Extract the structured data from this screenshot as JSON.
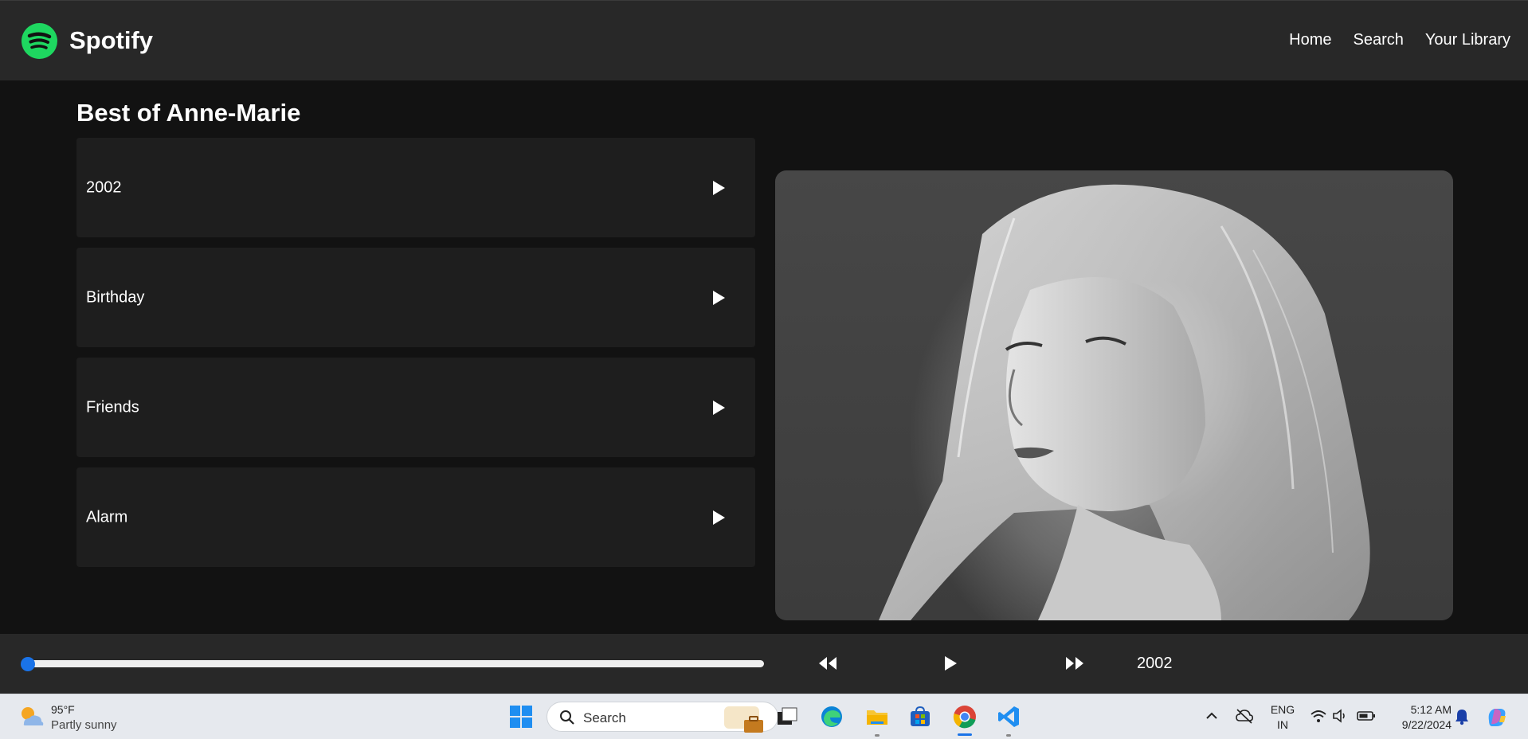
{
  "header": {
    "brand": "Spotify",
    "nav": [
      "Home",
      "Search",
      "Your Library"
    ],
    "colors": {
      "brand_green": "#1ed760",
      "header_bg": "#282828"
    }
  },
  "main": {
    "title": "Best of Anne-Marie",
    "songs": [
      {
        "name": "2002",
        "icon": "play-icon"
      },
      {
        "name": "Birthday",
        "icon": "play-icon"
      },
      {
        "name": "Friends",
        "icon": "play-icon"
      },
      {
        "name": "Alarm",
        "icon": "play-icon"
      }
    ],
    "artist_image": "artist-photo"
  },
  "player": {
    "progress": 0,
    "controls": [
      "rewind-icon",
      "play-icon",
      "fast-forward-icon"
    ],
    "now_playing": "2002",
    "accent": "#1a73e8"
  },
  "taskbar": {
    "weather": {
      "temp": "95°F",
      "desc": "Partly sunny",
      "icon": "partly-sunny-icon"
    },
    "search_placeholder": "Search",
    "apps": [
      "windows-start-icon",
      "task-view-icon",
      "edge-icon",
      "file-explorer-icon",
      "store-icon",
      "chrome-icon",
      "vscode-icon"
    ],
    "tray": {
      "lang": "ENG",
      "region": "IN",
      "time": "5:12 AM",
      "date": "9/22/2024"
    }
  }
}
